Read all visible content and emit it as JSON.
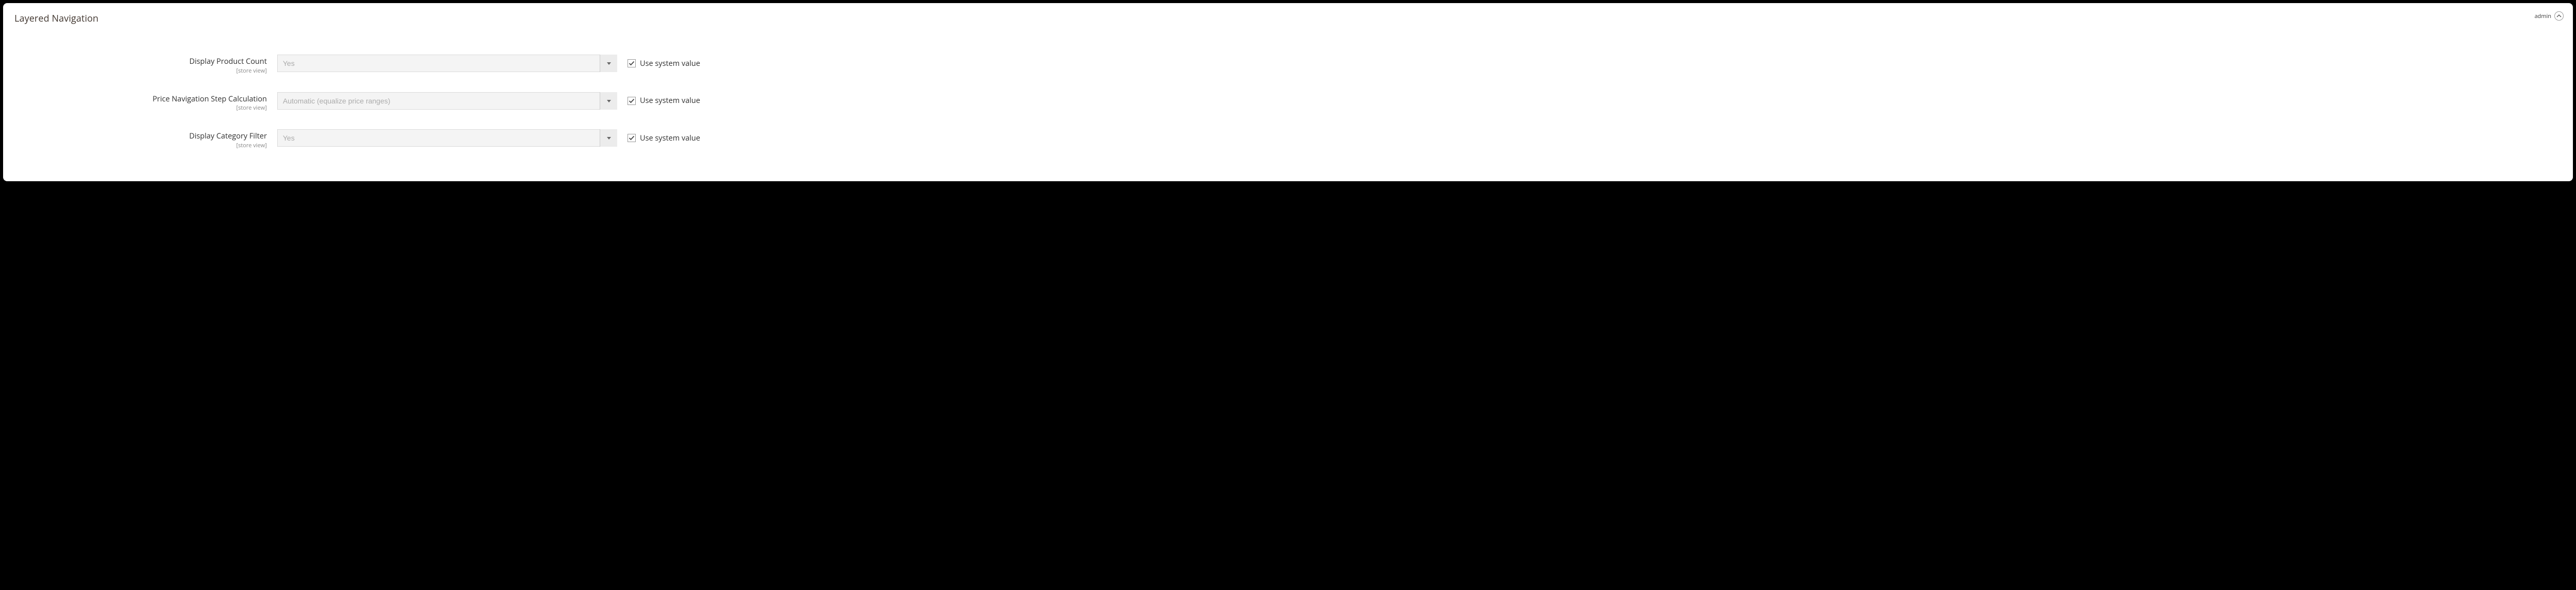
{
  "section": {
    "title": "Layered Navigation",
    "admin_label": "admin"
  },
  "fields": [
    {
      "label": "Display Product Count",
      "scope": "[store view]",
      "value": "Yes",
      "use_system_label": "Use system value",
      "use_system_checked": true
    },
    {
      "label": "Price Navigation Step Calculation",
      "scope": "[store view]",
      "value": "Automatic (equalize price ranges)",
      "use_system_label": "Use system value",
      "use_system_checked": true
    },
    {
      "label": "Display Category Filter",
      "scope": "[store view]",
      "value": "Yes",
      "use_system_label": "Use system value",
      "use_system_checked": true
    }
  ]
}
